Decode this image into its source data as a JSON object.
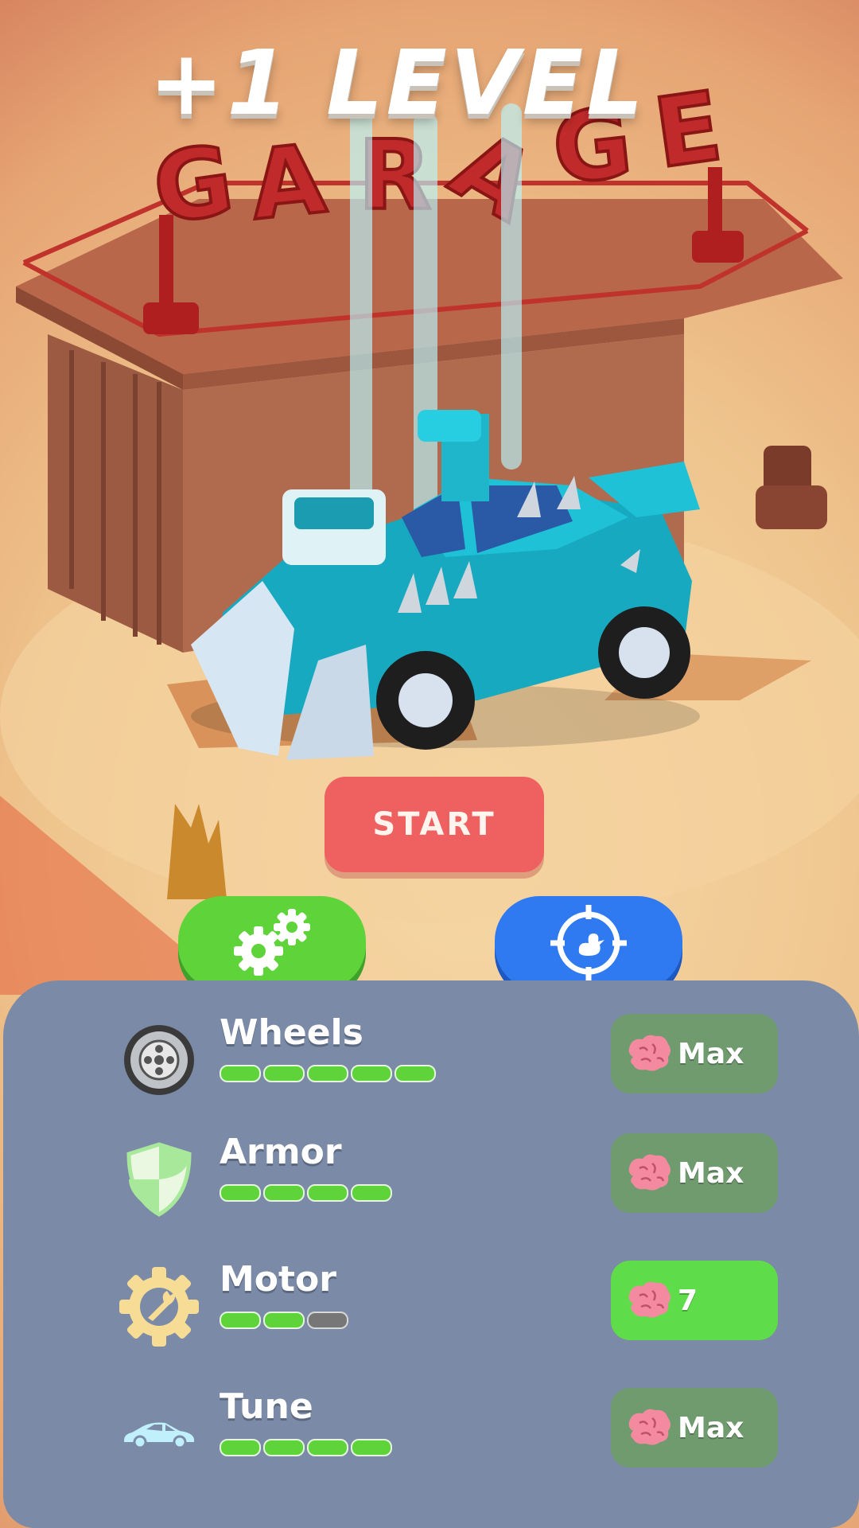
{
  "hud": {
    "title": "+1 LEVEL",
    "start_label": "START"
  },
  "tabs": [
    {
      "icon": "gears-icon",
      "color": "#5fd33a",
      "selected": true
    },
    {
      "icon": "duck-crosshair-icon",
      "color": "#2f7af0",
      "selected": false
    }
  ],
  "upgrades": [
    {
      "label": "Wheels",
      "icon": "wheel-icon",
      "level": 5,
      "max_level": 5,
      "cost": "Max",
      "maxed": true
    },
    {
      "label": "Armor",
      "icon": "shield-icon",
      "level": 4,
      "max_level": 4,
      "cost": "Max",
      "maxed": true
    },
    {
      "label": "Motor",
      "icon": "wrench-gear-icon",
      "level": 2,
      "max_level": 3,
      "cost": "7",
      "maxed": false
    },
    {
      "label": "Tune",
      "icon": "car-icon",
      "level": 4,
      "max_level": 4,
      "cost": "Max",
      "maxed": true
    }
  ],
  "currency_icon": "brain-icon",
  "colors": {
    "start": "#ef6160",
    "upgrade_tab": "#5fd33a",
    "hunt_tab": "#2f7af0",
    "panel": "#7b8aa6",
    "pip_filled": "#5fd33a",
    "pip_empty": "#777777"
  }
}
